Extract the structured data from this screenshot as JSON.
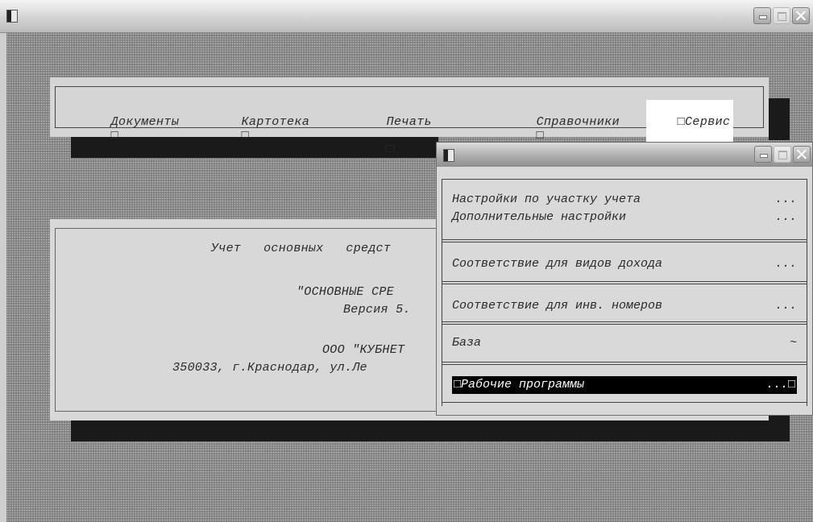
{
  "window": {
    "icon": "app-icon"
  },
  "menu": {
    "items": [
      {
        "label": "Документы",
        "box": "□"
      },
      {
        "label": "Картотека",
        "box": "□"
      },
      {
        "label": "Печать",
        "box": "□"
      },
      {
        "label": "Справочники",
        "box": "□"
      },
      {
        "label": "Сервис",
        "box_left": "□",
        "box_right": "□□",
        "active": true
      }
    ]
  },
  "about": {
    "line1": "Учет   основных   средст",
    "line2": "\"ОСНОВНЫЕ СРЕ",
    "line3": "Версия 5.",
    "line4": "ООО \"КУБНЕТ",
    "line5": "350033, г.Краснодар, ул.Ле"
  },
  "service_menu": {
    "items": [
      {
        "label": "Настройки по участку учета",
        "suffix": "..."
      },
      {
        "label": "Дополнительные настройки",
        "suffix": "..."
      },
      {
        "label": "Соответствие для видов дохода",
        "suffix": "..."
      },
      {
        "label": "Соответствие для инв. номеров",
        "suffix": "..."
      },
      {
        "label": "База",
        "suffix": "~"
      },
      {
        "label": "□Рабочие программы",
        "suffix": "...□",
        "selected": true
      }
    ]
  },
  "colors": {
    "desktop": "#858585",
    "panel": "#d8d8d8",
    "highlight_bg": "#000000",
    "highlight_fg": "#ffffff"
  }
}
